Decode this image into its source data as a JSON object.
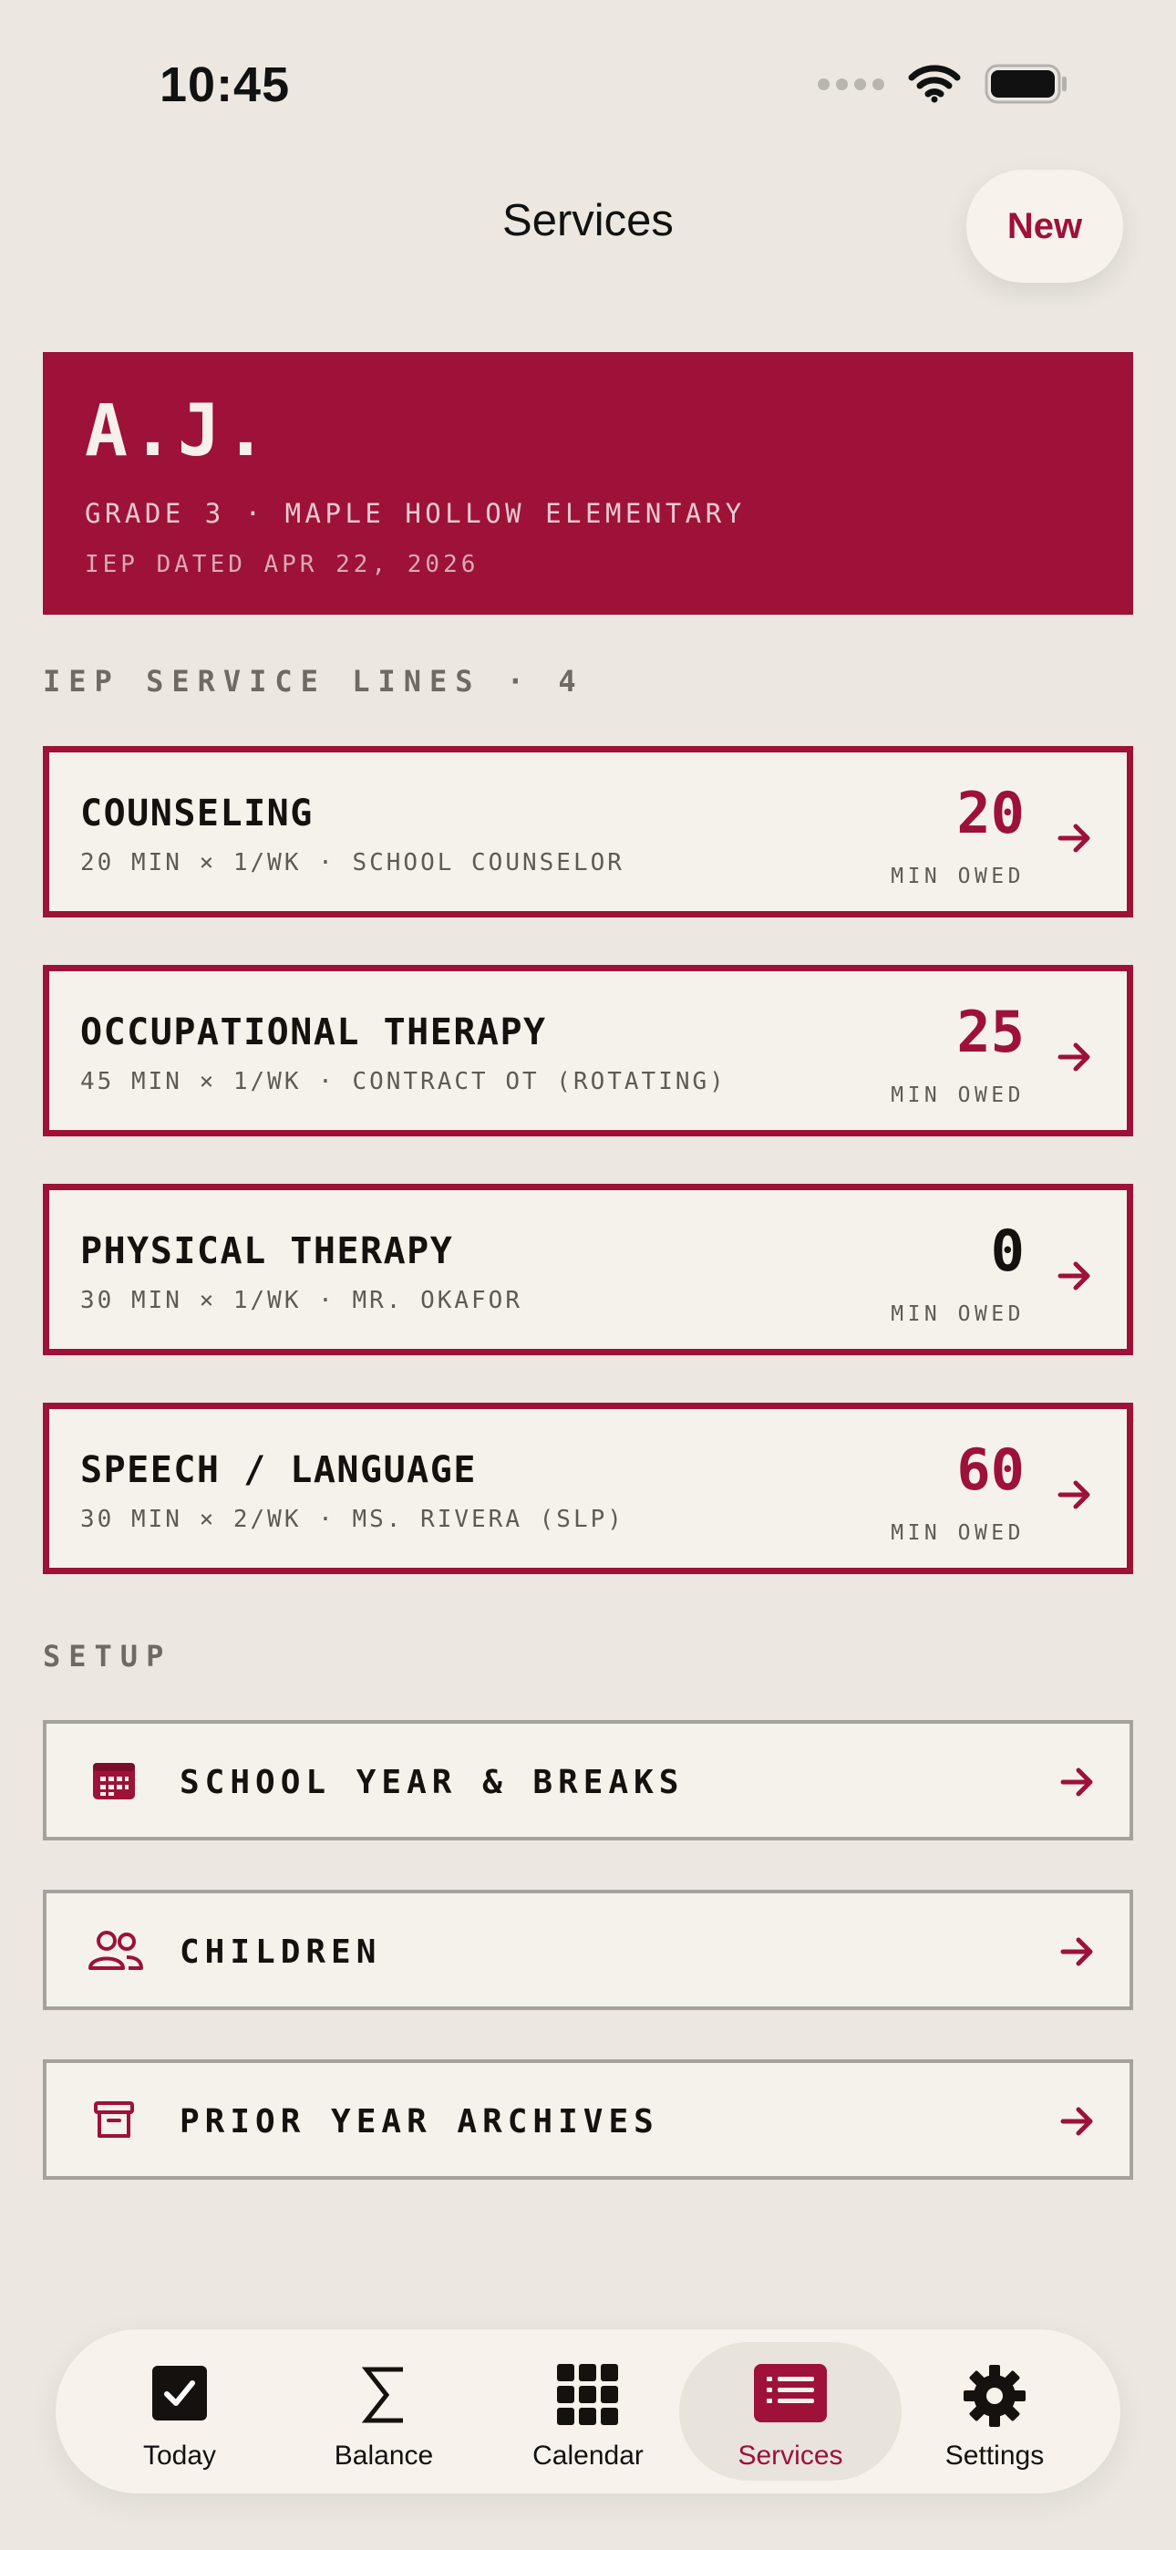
{
  "status": {
    "time": "10:45"
  },
  "header": {
    "title": "Services",
    "new_label": "New"
  },
  "student": {
    "name": "A.J.",
    "school_line": "GRADE 3 · MAPLE HOLLOW ELEMENTARY",
    "iep_line": "IEP DATED APR 22, 2026"
  },
  "services_section": {
    "label": "IEP SERVICE LINES · 4"
  },
  "services": [
    {
      "name": "COUNSELING",
      "detail": "20 MIN × 1/WK · SCHOOL COUNSELOR",
      "owed": "20",
      "owed_label": "MIN OWED"
    },
    {
      "name": "OCCUPATIONAL THERAPY",
      "detail": "45 MIN × 1/WK · CONTRACT OT (ROTATING)",
      "owed": "25",
      "owed_label": "MIN OWED"
    },
    {
      "name": "PHYSICAL THERAPY",
      "detail": "30 MIN × 1/WK · MR. OKAFOR",
      "owed": "0",
      "owed_label": "MIN OWED"
    },
    {
      "name": "SPEECH / LANGUAGE",
      "detail": "30 MIN × 2/WK · MS. RIVERA (SLP)",
      "owed": "60",
      "owed_label": "MIN OWED"
    }
  ],
  "setup_section": {
    "label": "SETUP"
  },
  "setup": [
    {
      "label": "SCHOOL YEAR & BREAKS",
      "icon": "calendar-icon"
    },
    {
      "label": "CHILDREN",
      "icon": "people-icon"
    },
    {
      "label": "PRIOR YEAR ARCHIVES",
      "icon": "archive-box-icon"
    }
  ],
  "tabs": [
    {
      "label": "Today",
      "icon": "checkbox-icon"
    },
    {
      "label": "Balance",
      "icon": "sigma-icon"
    },
    {
      "label": "Calendar",
      "icon": "grid-icon"
    },
    {
      "label": "Services",
      "icon": "list-icon",
      "active": true
    },
    {
      "label": "Settings",
      "icon": "gear-icon"
    }
  ],
  "colors": {
    "accent": "#9d1236",
    "background": "#ece8e1",
    "card": "#f5f2ec"
  }
}
